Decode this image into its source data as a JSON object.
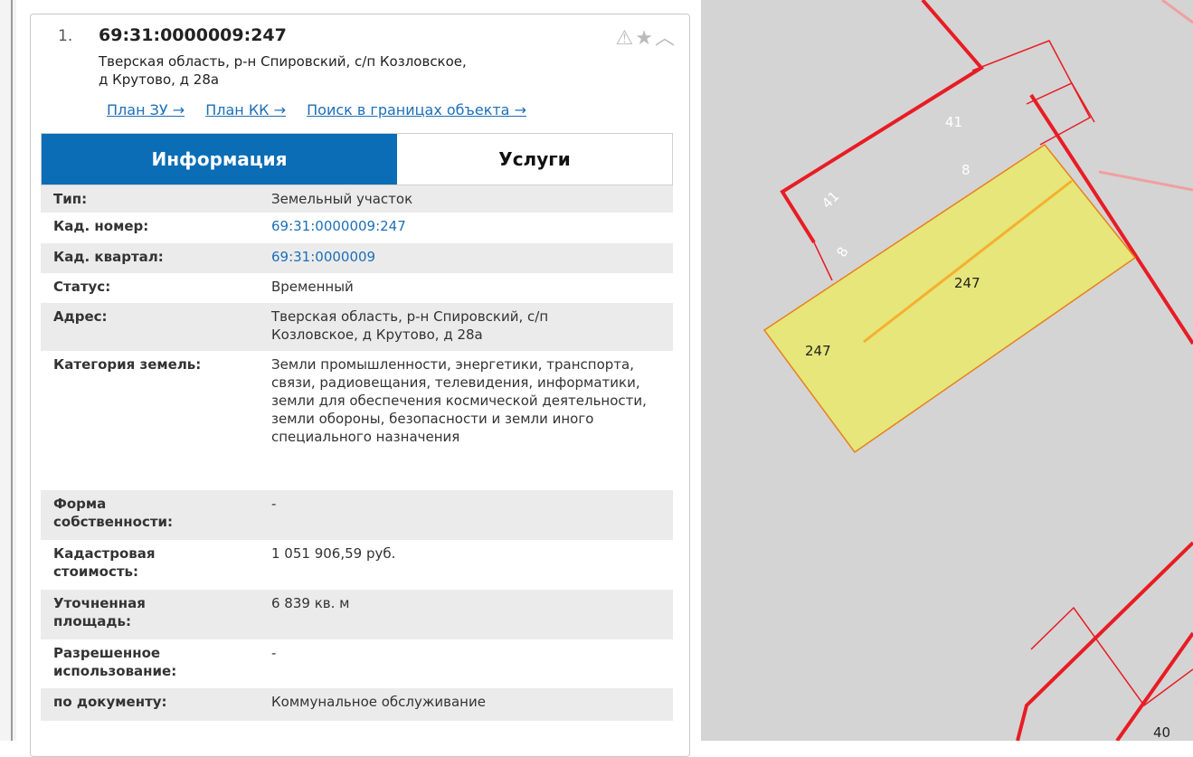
{
  "result": {
    "index": "1.",
    "cadastral_number": "69:31:0000009:247",
    "address_line1": "Тверская область, р-н Спировский, с/п Козловское,",
    "address_line2": "д Крутово, д 28а"
  },
  "links": {
    "plan_zu": "План ЗУ →",
    "plan_kk": "План КК →",
    "search_bounds": "Поиск в границах объекта →"
  },
  "tabs": {
    "info": "Информация",
    "services": "Услуги"
  },
  "rows": [
    {
      "key": "Тип:",
      "value": "Земельный участок"
    },
    {
      "key": "Кад. номер:",
      "value": "69:31:0000009:247"
    },
    {
      "key": "Кад. квартал:",
      "value": "69:31:0000009"
    },
    {
      "key": "Статус:",
      "value": "Временный"
    },
    {
      "key": "Адрес:",
      "value": "Тверская область, р-н Спировский, с/п Козловское, д Крутово, д 28а"
    },
    {
      "key": "Категория земель:",
      "value": "Земли промышленности, энергетики, транспорта, связи, радиовещания, телевидения, информатики, земли для обеспечения космической деятельности, земли обороны, безопасности и земли иного специального назначения"
    },
    {
      "key": "Форма собственности:",
      "value": "-"
    },
    {
      "key": "Кадастровая стоимость:",
      "value": "1 051 906,59 руб."
    },
    {
      "key": "Уточненная площадь:",
      "value": "6 839 кв. м"
    },
    {
      "key": "Разрешенное использование:",
      "value": "-"
    },
    {
      "key": "по документу:",
      "value": "Коммунальное обслуживание"
    }
  ],
  "map": {
    "labels": {
      "a": "41",
      "b": "41",
      "c": "8",
      "d": "8",
      "e": "247",
      "f": "247",
      "g": "40"
    },
    "colors": {
      "parcel_fill": "#e6e67a",
      "boundary": "#e81c24",
      "background": "#d4d4d4"
    }
  },
  "icons": [
    "warning-icon",
    "star-icon",
    "chevron-up-icon"
  ]
}
